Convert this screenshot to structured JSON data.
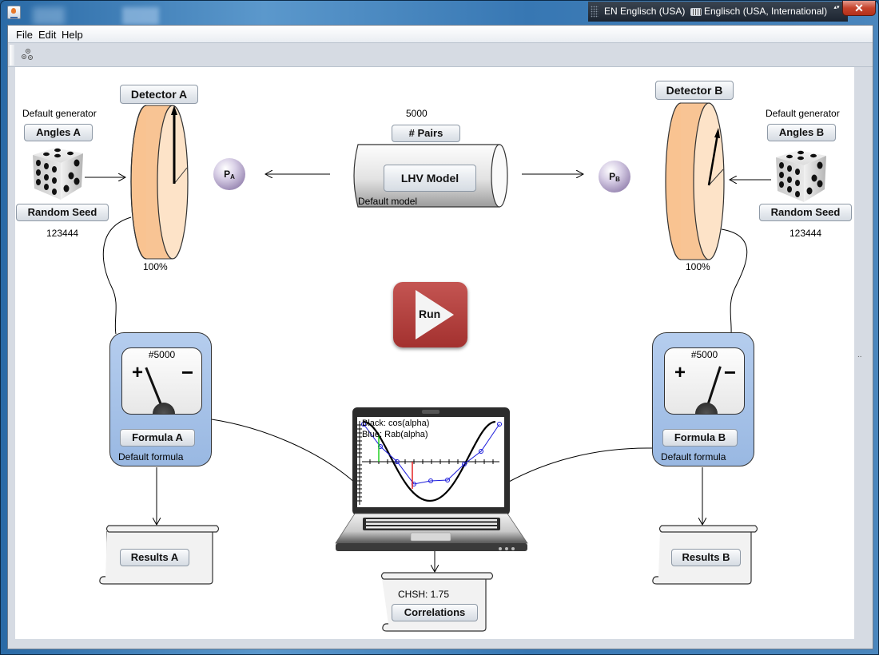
{
  "window": {
    "title": "",
    "close_glyph": "✕"
  },
  "langbar": {
    "language": "EN Englisch (USA)",
    "layout": "Englisch (USA, International)",
    "arrows_glyph": "▴▾"
  },
  "menubar": {
    "items": [
      "File",
      "Edit",
      "Help"
    ]
  },
  "toolbar": {
    "icons": [
      "gears-icon"
    ]
  },
  "source_a": {
    "generator_label": "Default generator",
    "angles_button": "Angles A",
    "seed_button": "Random Seed",
    "seed_value": "123444"
  },
  "source_b": {
    "generator_label": "Default generator",
    "angles_button": "Angles B",
    "seed_button": "Random Seed",
    "seed_value": "123444"
  },
  "detector_a": {
    "button": "Detector A",
    "efficiency": "100%"
  },
  "detector_b": {
    "button": "Detector B",
    "efficiency": "100%"
  },
  "source": {
    "pairs_value": "5000",
    "pairs_button": "# Pairs",
    "model_button": "LHV Model",
    "model_label": "Default model"
  },
  "particles": {
    "a": {
      "letter": "P",
      "sub": "A"
    },
    "b": {
      "letter": "P",
      "sub": "B"
    }
  },
  "run": {
    "label": "Run"
  },
  "meter_a": {
    "count": "#5000",
    "plus": "+",
    "minus": "−",
    "button": "Formula A",
    "formula_label": "Default formula"
  },
  "meter_b": {
    "count": "#5000",
    "plus": "+",
    "minus": "−",
    "button": "Formula B",
    "formula_label": "Default formula"
  },
  "laptop_plot": {
    "legend_black": "Black: cos(alpha)",
    "legend_blue": "Blue:  Rab(alpha)"
  },
  "results_a": {
    "button": "Results A"
  },
  "results_b": {
    "button": "Results B"
  },
  "correlations": {
    "chsh": "CHSH: 1.75",
    "button": "Correlations"
  },
  "side_indicator": ".."
}
